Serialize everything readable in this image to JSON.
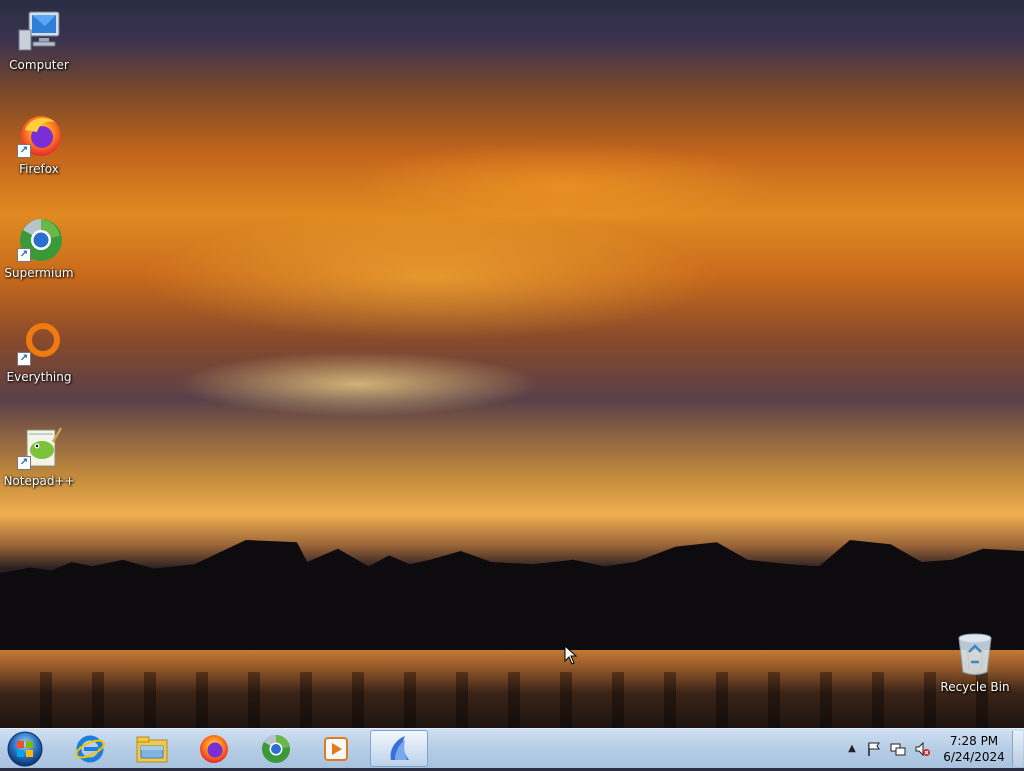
{
  "desktop": {
    "icons": [
      {
        "label": "Computer",
        "icon": "computer-icon"
      },
      {
        "label": "Firefox",
        "icon": "firefox-icon"
      },
      {
        "label": "Supermium",
        "icon": "supermium-icon"
      },
      {
        "label": "Everything",
        "icon": "everything-icon"
      },
      {
        "label": "Notepad++",
        "icon": "notepadpp-icon"
      },
      {
        "label": "Recycle Bin",
        "icon": "recycle-bin-icon"
      }
    ]
  },
  "taskbar": {
    "start_icon": "windows-start-icon",
    "pinned": [
      {
        "icon": "internet-explorer-icon"
      },
      {
        "icon": "file-explorer-icon"
      },
      {
        "icon": "firefox-icon"
      },
      {
        "icon": "supermium-icon"
      },
      {
        "icon": "media-player-icon"
      },
      {
        "icon": "active-app-icon"
      }
    ],
    "tray": {
      "time": "7:28 PM",
      "date": "6/24/2024"
    }
  },
  "colors": {
    "taskbar": "#b6cde6",
    "label_text": "#ffffff"
  }
}
